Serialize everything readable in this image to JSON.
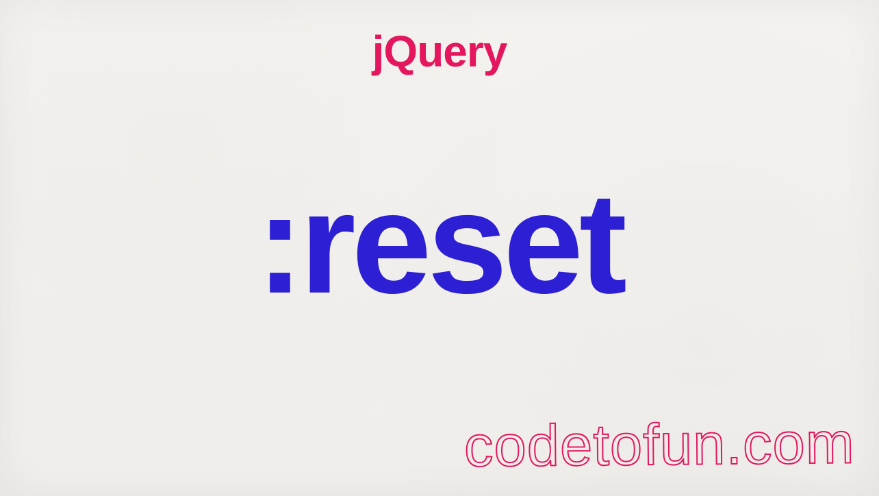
{
  "header": {
    "title": "jQuery"
  },
  "main": {
    "selector": ":reset"
  },
  "footer": {
    "watermark": "codetofun.com"
  },
  "colors": {
    "title": "#e3165e",
    "selector": "#2d1fd4",
    "watermark_stroke": "#e3165e",
    "background": "#f2f0ed"
  }
}
